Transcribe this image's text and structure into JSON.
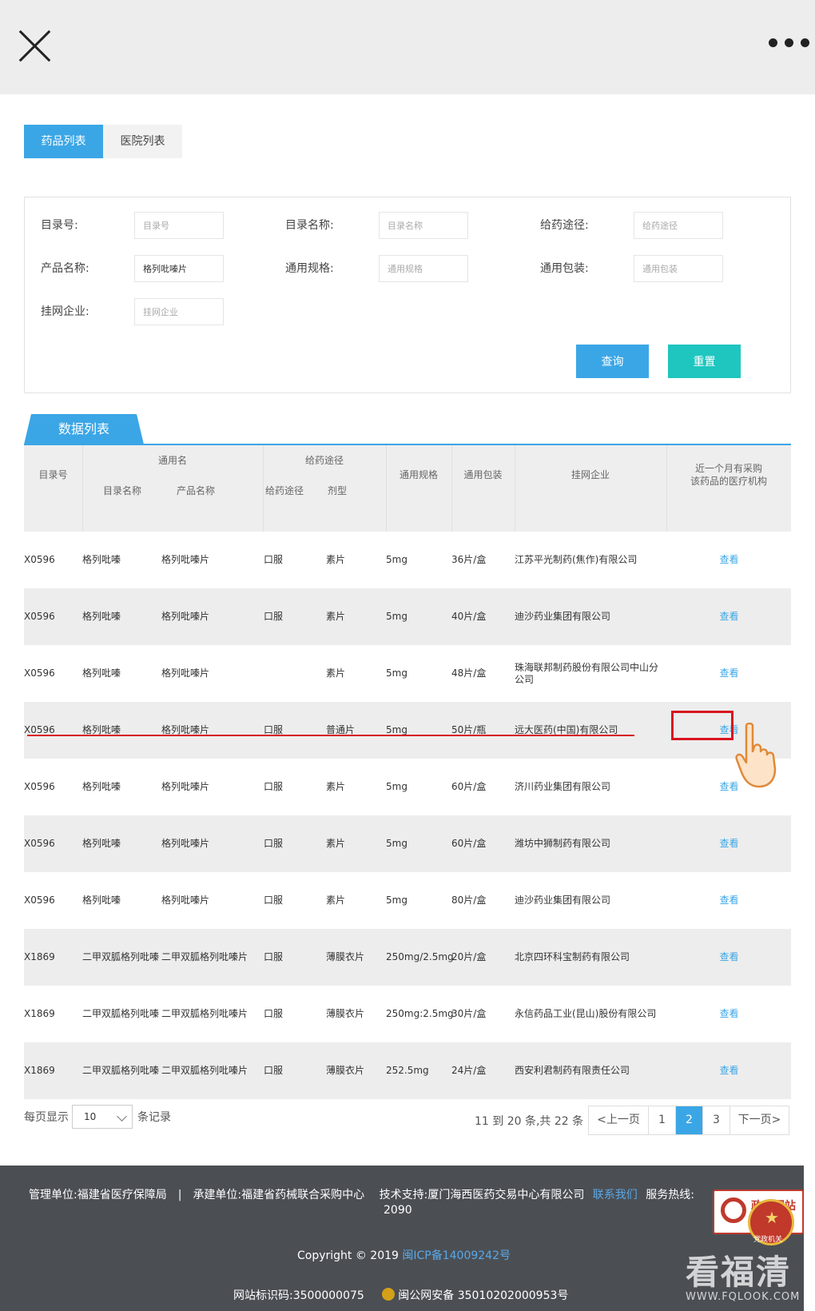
{
  "tabs": [
    {
      "label": "药品列表",
      "active": true
    },
    {
      "label": "医院列表",
      "active": false
    }
  ],
  "filters": {
    "catalog_no": {
      "label": "目录号:",
      "placeholder": "目录号",
      "value": ""
    },
    "catalog_name": {
      "label": "目录名称:",
      "placeholder": "目录名称",
      "value": ""
    },
    "route": {
      "label": "给药途径:",
      "placeholder": "给药途径",
      "value": ""
    },
    "product_name": {
      "label": "产品名称:",
      "placeholder": "产品名称",
      "value": "格列吡嗪片"
    },
    "spec": {
      "label": "通用规格:",
      "placeholder": "通用规格",
      "value": ""
    },
    "package": {
      "label": "通用包装:",
      "placeholder": "通用包装",
      "value": ""
    },
    "enterprise": {
      "label": "挂网企业:",
      "placeholder": "挂网企业",
      "value": ""
    },
    "query_label": "查询",
    "reset_label": "重置"
  },
  "data_list": {
    "tab_label": "数据列表",
    "headers": {
      "code": "目录号",
      "generic_group": "通用名",
      "generic_name": "目录名称",
      "product_name": "产品名称",
      "route_group": "给药途径",
      "route": "给药途径",
      "form": "剂型",
      "spec": "通用规格",
      "pack": "通用包装",
      "enterprise": "挂网企业",
      "hospitals_line1": "近一个月有采购",
      "hospitals_line2": "该药品的医疗机构"
    },
    "rows": [
      {
        "code": "X0596",
        "generic_name": "格列吡嗪",
        "product_name": "格列吡嗪片",
        "route": "口服",
        "form": "素片",
        "spec": "5mg",
        "pack": "36片/盒",
        "enterprise": "江苏平光制药(焦作)有限公司",
        "view": "查看"
      },
      {
        "code": "X0596",
        "generic_name": "格列吡嗪",
        "product_name": "格列吡嗪片",
        "route": "口服",
        "form": "素片",
        "spec": "5mg",
        "pack": "40片/盒",
        "enterprise": "迪沙药业集团有限公司",
        "view": "查看"
      },
      {
        "code": "X0596",
        "generic_name": "格列吡嗪",
        "product_name": "格列吡嗪片",
        "route": "",
        "form": "素片",
        "spec": "5mg",
        "pack": "48片/盒",
        "enterprise": "珠海联邦制药股份有限公司中山分公司",
        "view": "查看"
      },
      {
        "code": "X0596",
        "generic_name": "格列吡嗪",
        "product_name": "格列吡嗪片",
        "route": "口服",
        "form": "普通片",
        "spec": "5mg",
        "pack": "50片/瓶",
        "enterprise": "远大医药(中国)有限公司",
        "view": "查看"
      },
      {
        "code": "X0596",
        "generic_name": "格列吡嗪",
        "product_name": "格列吡嗪片",
        "route": "口服",
        "form": "素片",
        "spec": "5mg",
        "pack": "60片/盒",
        "enterprise": "济川药业集团有限公司",
        "view": "查看"
      },
      {
        "code": "X0596",
        "generic_name": "格列吡嗪",
        "product_name": "格列吡嗪片",
        "route": "口服",
        "form": "素片",
        "spec": "5mg",
        "pack": "60片/盒",
        "enterprise": "潍坊中狮制药有限公司",
        "view": "查看"
      },
      {
        "code": "X0596",
        "generic_name": "格列吡嗪",
        "product_name": "格列吡嗪片",
        "route": "口服",
        "form": "素片",
        "spec": "5mg",
        "pack": "80片/盒",
        "enterprise": "迪沙药业集团有限公司",
        "view": "查看"
      },
      {
        "code": "X1869",
        "generic_name": "二甲双胍格列吡嗪",
        "product_name": "二甲双胍格列吡嗪片",
        "route": "口服",
        "form": "薄膜衣片",
        "spec": "250mg/2.5mg",
        "pack": "20片/盒",
        "enterprise": "北京四环科宝制药有限公司",
        "view": "查看"
      },
      {
        "code": "X1869",
        "generic_name": "二甲双胍格列吡嗪",
        "product_name": "二甲双胍格列吡嗪片",
        "route": "口服",
        "form": "薄膜衣片",
        "spec": "250mg:2.5mg",
        "pack": "30片/盒",
        "enterprise": "永信药品工业(昆山)股份有限公司",
        "view": "查看"
      },
      {
        "code": "X1869",
        "generic_name": "二甲双胍格列吡嗪",
        "product_name": "二甲双胍格列吡嗪片",
        "route": "口服",
        "form": "薄膜衣片",
        "spec": "252.5mg",
        "pack": "24片/盒",
        "enterprise": "西安利君制药有限责任公司",
        "view": "查看"
      }
    ]
  },
  "pagination": {
    "per_page_label": "每页显示",
    "per_page_value": "10",
    "records_label": "条记录",
    "info": "11 到 20 条,共 22 条",
    "prev": "<上一页",
    "pages": [
      "1",
      "2",
      "3"
    ],
    "current_page": "2",
    "next": "下一页>"
  },
  "footer": {
    "admin": "管理单位:福建省医疗保障局",
    "operator": "承建单位:福建省药械联合采购中心",
    "tech": "技术支持:厦门海西医药交易中心有限公司",
    "contact": "联系我们",
    "hotline_prefix": "服务热线:",
    "hotline_tail": "2090",
    "copyright": "Copyright © 2019",
    "icp": "闽ICP备14009242号",
    "site_code": "网站标识码:3500000075",
    "police": "闽公网安备 35010202000953号"
  },
  "gov_badge": {
    "text": "政府网站",
    "emblem_text": "党政机关"
  },
  "watermark": {
    "big": "看福清",
    "small": "WWW.FQLOOK.COM"
  },
  "colors": {
    "accent": "#3ba6e6",
    "reset": "#1ec6bf",
    "highlight": "#d8141f"
  }
}
